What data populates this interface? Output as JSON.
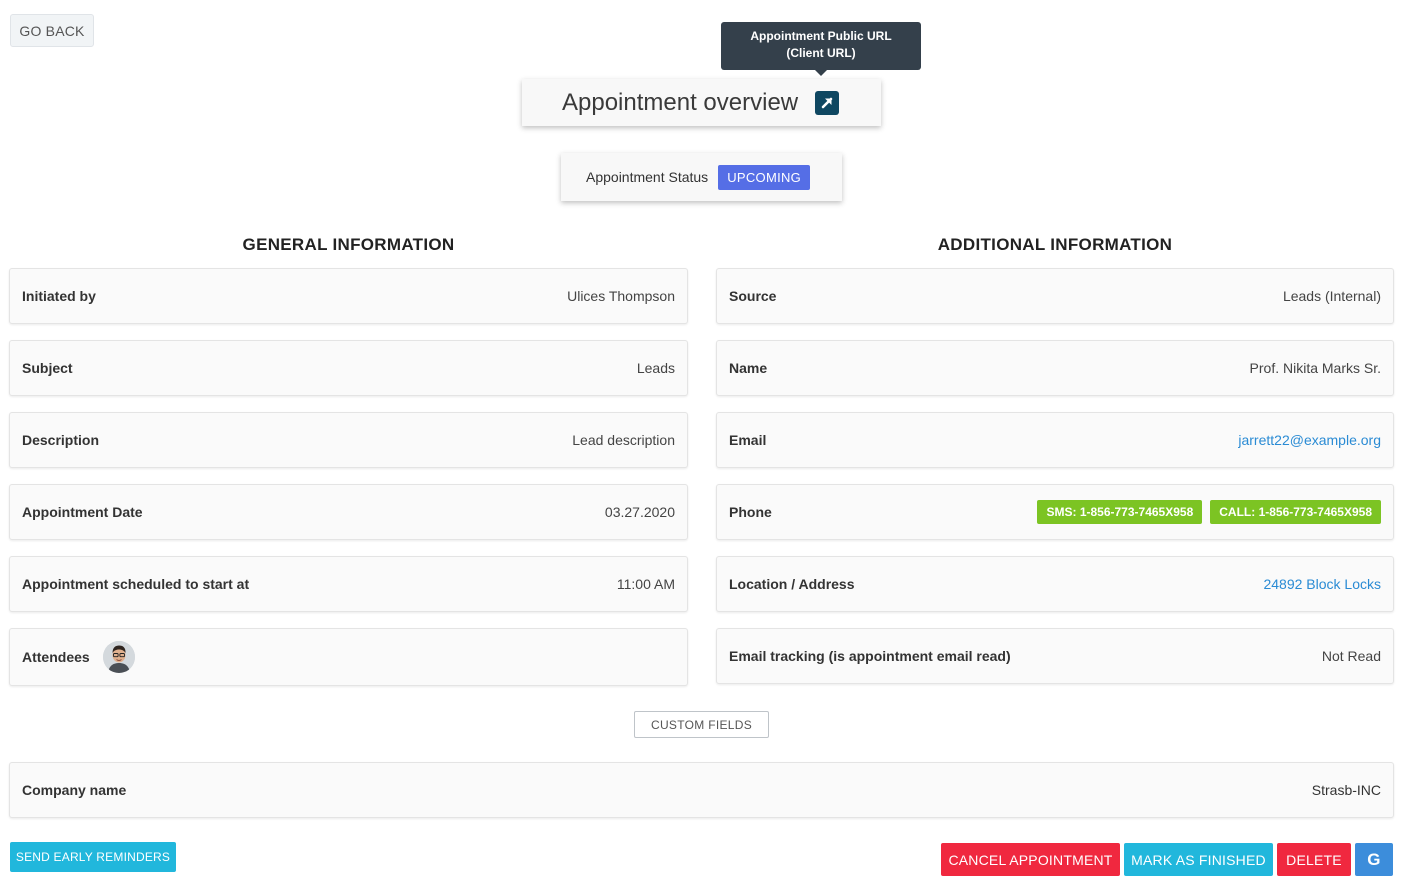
{
  "top": {
    "go_back": "GO BACK",
    "tooltip": "Appointment Public URL (Client URL)",
    "overview_title": "Appointment overview",
    "status_label": "Appointment Status",
    "status_value": "UPCOMING"
  },
  "colors": {
    "status_badge": "#556ee6",
    "phone_badge": "#7cc423",
    "cyan_button": "#21b7dc",
    "red_button": "#f0283f",
    "google_button": "#3c8ddb",
    "link": "#2a8bd4"
  },
  "general": {
    "title": "GENERAL INFORMATION",
    "rows": [
      {
        "label": "Initiated by",
        "value": "Ulices Thompson"
      },
      {
        "label": "Subject",
        "value": "Leads"
      },
      {
        "label": "Description",
        "value": "Lead description"
      },
      {
        "label": "Appointment Date",
        "value": "03.27.2020"
      },
      {
        "label": "Appointment scheduled to start at",
        "value": "11:00 AM"
      },
      {
        "label": "Attendees",
        "value": ""
      }
    ]
  },
  "additional": {
    "title": "ADDITIONAL INFORMATION",
    "rows": [
      {
        "label": "Source",
        "value": "Leads (Internal)"
      },
      {
        "label": "Name",
        "value": "Prof. Nikita Marks Sr."
      },
      {
        "label": "Email",
        "value": "jarrett22@example.org"
      },
      {
        "label": "Phone",
        "sms": "SMS: 1-856-773-7465X958",
        "call": "CALL: 1-856-773-7465X958"
      },
      {
        "label": "Location / Address",
        "value": "24892 Block Locks"
      },
      {
        "label": "Email tracking (is appointment email read)",
        "value": "Not Read"
      }
    ]
  },
  "custom": {
    "button": "CUSTOM FIELDS",
    "company_label": "Company name",
    "company_value": "Strasb-INC"
  },
  "actions": {
    "send_reminders": "SEND EARLY REMINDERS",
    "cancel": "CANCEL APPOINTMENT",
    "mark_finished": "MARK AS FINISHED",
    "delete": "DELETE",
    "google": "G"
  },
  "icons": {
    "external_link": "external-link-icon",
    "avatar": "attendee-avatar",
    "google": "google-icon"
  }
}
